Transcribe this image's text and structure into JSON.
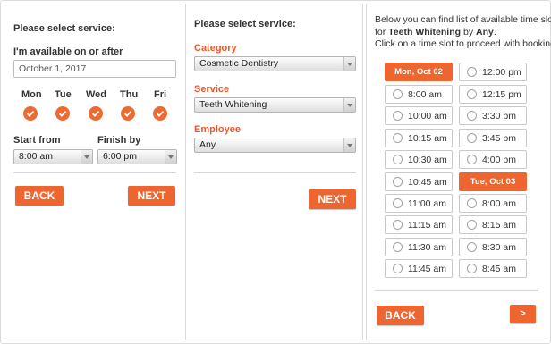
{
  "step1": {
    "heading": "Please select service:",
    "available_label": "I'm available on or after",
    "date_value": "October 1, 2017",
    "days": [
      "Mon",
      "Tue",
      "Wed",
      "Thu",
      "Fri"
    ],
    "start_label": "Start from",
    "start_value": "8:00 am",
    "finish_label": "Finish by",
    "finish_value": "6:00 pm",
    "back_label": "BACK",
    "next_label": "NEXT"
  },
  "step2": {
    "heading": "Please select service:",
    "category_label": "Category",
    "category_value": "Cosmetic Dentistry",
    "service_label": "Service",
    "service_value": "Teeth Whitening",
    "employee_label": "Employee",
    "employee_value": "Any",
    "next_label": "NEXT"
  },
  "step3": {
    "intro_line1": "Below you can find list of available time slots",
    "intro_for": "for ",
    "intro_service": "Teeth Whitening",
    "intro_by": " by ",
    "intro_employee": "Any",
    "intro_period": ".",
    "intro_line3": "Click on a time slot to proceed with booking.",
    "col1_header": "Mon, Oct 02",
    "col1_slots": [
      "8:00 am",
      "10:00 am",
      "10:15 am",
      "10:30 am",
      "10:45 am",
      "11:00 am",
      "11:15 am",
      "11:30 am",
      "11:45 am"
    ],
    "col2_slots_a": [
      "12:00 pm",
      "12:15 pm",
      "3:30 pm",
      "3:45 pm",
      "4:00 pm"
    ],
    "col2_header": "Tue, Oct 03",
    "col2_slots_b": [
      "8:00 am",
      "8:15 am",
      "8:30 am",
      "8:45 am"
    ],
    "back_label": "BACK",
    "more_label": ">"
  },
  "colors": {
    "accent": "#ef6530",
    "label_orange": "#e8572a"
  }
}
